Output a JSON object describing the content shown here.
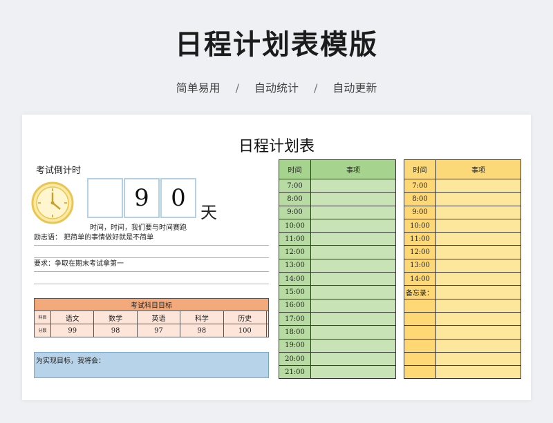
{
  "header": {
    "title": "日程计划表模版",
    "features": [
      "简单易用",
      "自动统计",
      "自动更新"
    ],
    "separator": "/"
  },
  "sheet": {
    "title": "日程计划表",
    "countdown": {
      "label": "考试倒计时",
      "digits": [
        "",
        "9",
        "0"
      ],
      "unit": "天",
      "slogan": "时间，时间，我们要与时间赛跑"
    },
    "motto": "励志语：  把简单的事情做好就是不简单",
    "requirement": "要求：争取在期末考试拿第一",
    "subjects": {
      "title": "考试科目目标",
      "row1_label": "科目",
      "row2_label": "分数",
      "names": [
        "语文",
        "数学",
        "英语",
        "科学",
        "历史",
        ""
      ],
      "scores": [
        "99",
        "98",
        "97",
        "98",
        "100",
        ""
      ]
    },
    "goal_label": "为实现目标，我将会：",
    "schedule_green": {
      "time_header": "时间",
      "item_header": "事项",
      "times": [
        "7:00",
        "8:00",
        "9:00",
        "10:00",
        "11:00",
        "12:00",
        "13:00",
        "14:00",
        "15:00",
        "16:00",
        "17:00",
        "18:00",
        "19:00",
        "20:00",
        "21:00"
      ]
    },
    "schedule_yellow": {
      "time_header": "时间",
      "item_header": "事项",
      "times": [
        "7:00",
        "8:00",
        "9:00",
        "10:00",
        "11:00",
        "12:00",
        "13:00",
        "14:00"
      ],
      "memo_label": "备忘录：",
      "empty_rows": 6
    }
  },
  "colors": {
    "green_header": "#a6d38e",
    "green_cell": "#c8e3b5",
    "yellow_header": "#fbd978",
    "yellow_cell": "#fde79c",
    "subject_header": "#f4a97a",
    "goal_box": "#b6d3ea"
  }
}
